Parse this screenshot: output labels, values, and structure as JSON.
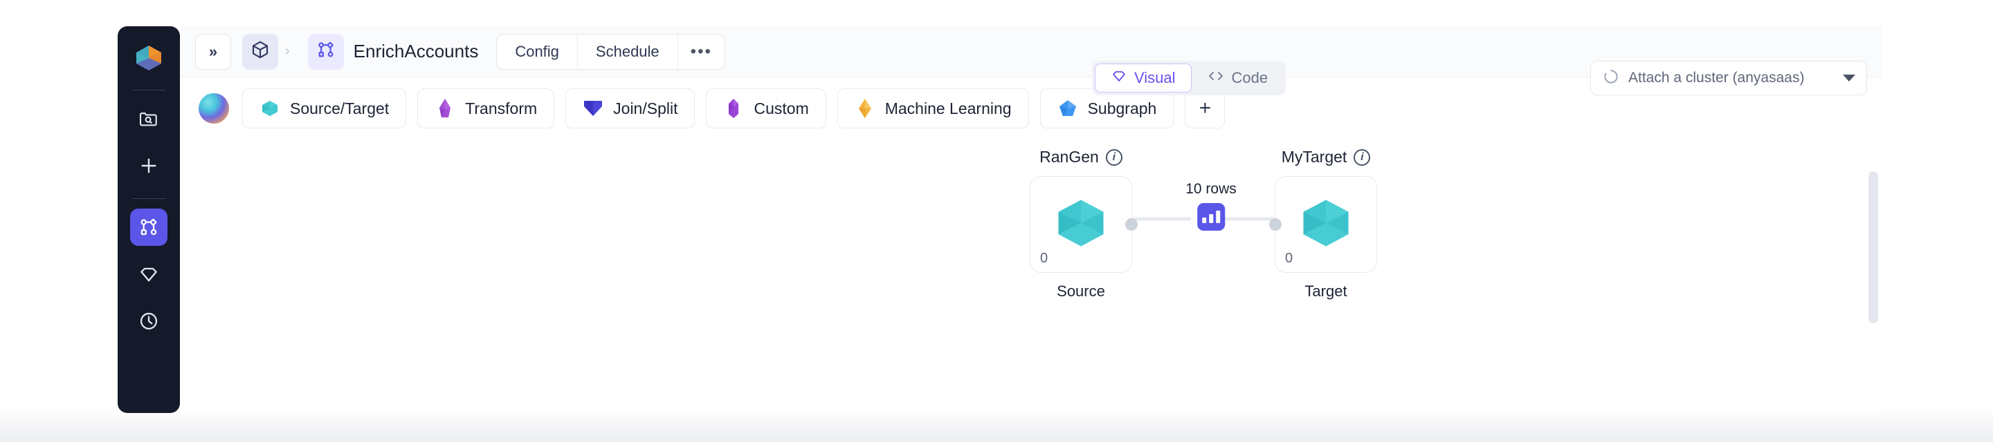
{
  "sidebar": {
    "logo_name": "brand-logo",
    "items": [
      {
        "icon": "folder-search-icon",
        "active": false
      },
      {
        "icon": "plus-icon",
        "active": false
      },
      {
        "icon": "pipeline-graph-icon",
        "active": true
      },
      {
        "icon": "gem-icon",
        "active": false
      },
      {
        "icon": "clock-history-icon",
        "active": false
      }
    ]
  },
  "header": {
    "collapse_label": "»",
    "breadcrumb": {
      "cube_icon": "cube-icon",
      "separator": "›",
      "flow_icon": "pipeline-graph-icon",
      "title": "EnrichAccounts"
    },
    "segmented": [
      {
        "label": "Config"
      },
      {
        "label": "Schedule"
      },
      {
        "label": "•••"
      }
    ],
    "view_toggle": [
      {
        "label": "Visual",
        "icon": "gem-icon",
        "active": true
      },
      {
        "label": "Code",
        "icon": "code-brackets-icon",
        "active": false
      }
    ],
    "cluster": {
      "label": "Attach a cluster (anyasaas)",
      "icon": "spinner-icon",
      "caret": "chevron-down-icon"
    }
  },
  "toolbar": {
    "sphere_icon": "sphere-icon",
    "categories": [
      {
        "label": "Source/Target",
        "icon": "hexagon-icon",
        "color": "#3fc6ce"
      },
      {
        "label": "Transform",
        "icon": "crystal-icon",
        "color": "#a44fd6"
      },
      {
        "label": "Join/Split",
        "icon": "chevron-v-icon",
        "color": "#3c35c4"
      },
      {
        "label": "Custom",
        "icon": "prism-icon",
        "color": "#9a45d8"
      },
      {
        "label": "Machine Learning",
        "icon": "diamond-icon",
        "color": "#f2b23e"
      },
      {
        "label": "Subgraph",
        "icon": "pentagon-icon",
        "color": "#3d96f0"
      }
    ],
    "add_label": "+"
  },
  "canvas": {
    "nodes": [
      {
        "title": "RanGen",
        "count": "0",
        "caption": "Source",
        "info_icon": "info-icon",
        "shape_icon": "hexagon-icon"
      },
      {
        "title": "MyTarget",
        "count": "0",
        "caption": "Target",
        "info_icon": "info-icon",
        "shape_icon": "hexagon-icon"
      }
    ],
    "edge": {
      "label": "10 rows",
      "chip_icon": "bar-chart-icon"
    },
    "scrollbar": "vertical-scrollbar"
  },
  "colors": {
    "accent": "#5b56e8",
    "visual_active": "#6c4ef0",
    "node_teal": "#3fc6ce",
    "rail_bg": "#141a2a"
  }
}
